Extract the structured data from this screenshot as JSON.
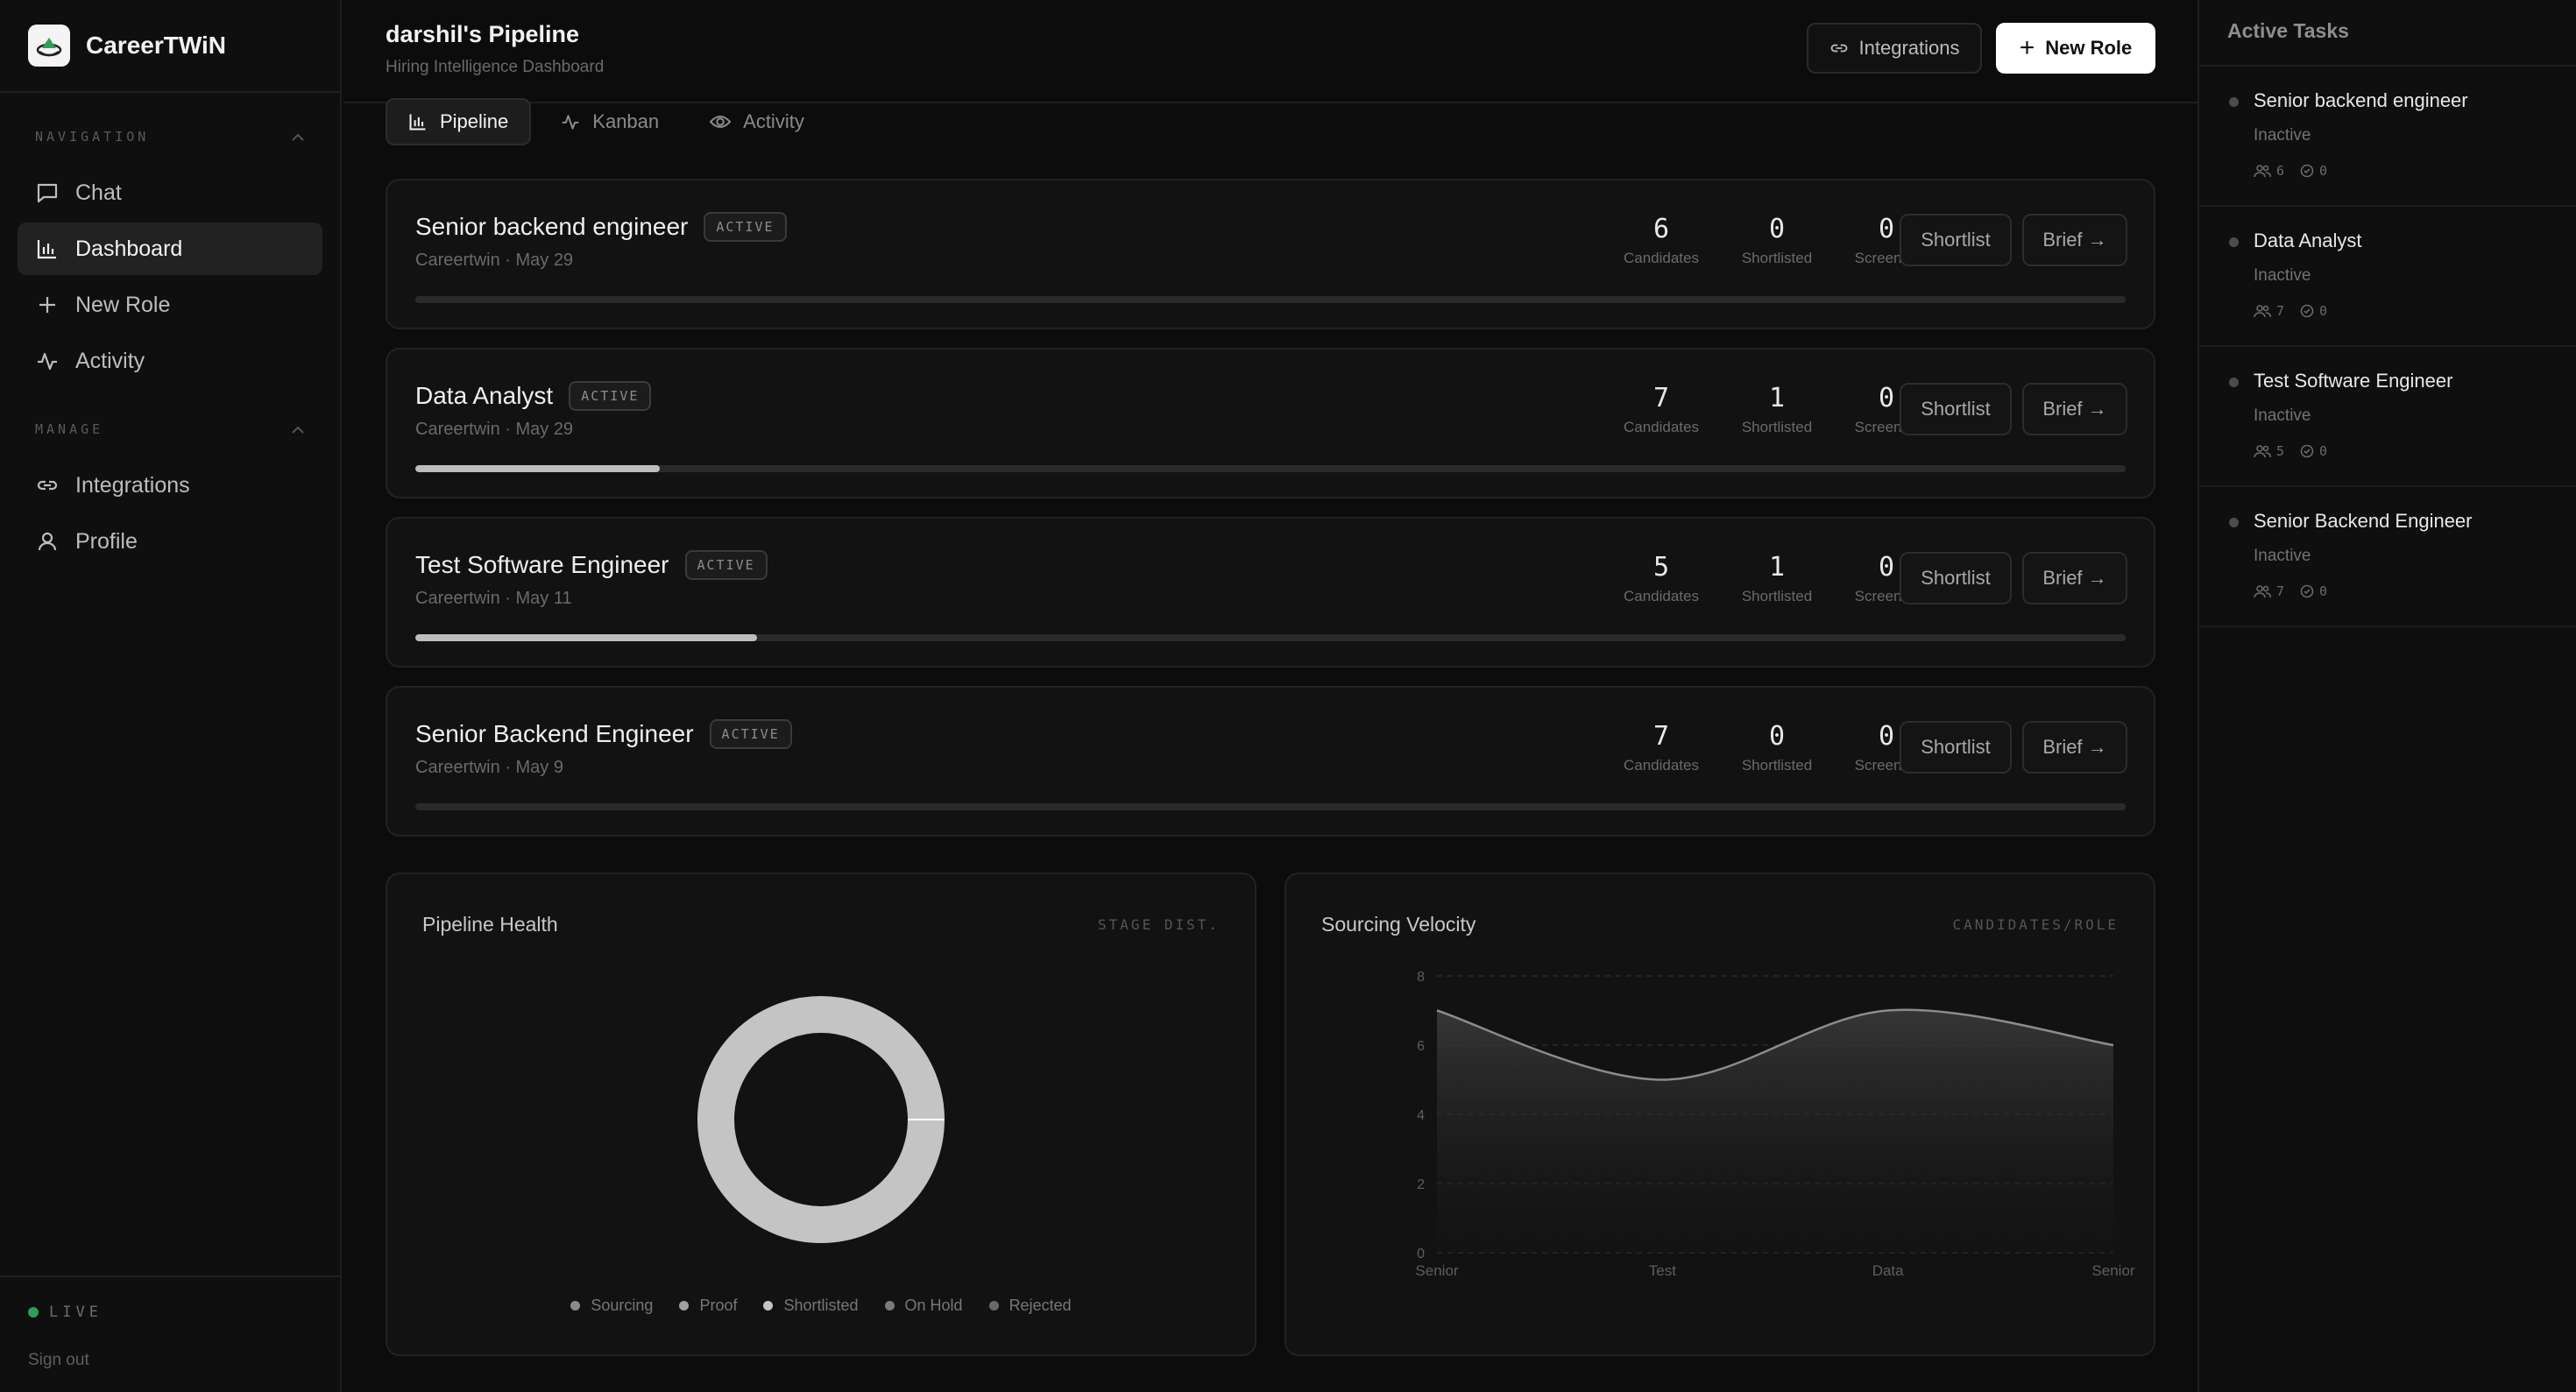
{
  "sidebar": {
    "brand": "CareerTWiN",
    "sections": [
      {
        "label": "NAVIGATION",
        "items": [
          {
            "label": "Chat",
            "icon": "chat-icon"
          },
          {
            "label": "Dashboard",
            "icon": "bar-chart-icon",
            "active": true
          },
          {
            "label": "New Role",
            "icon": "plus-icon"
          },
          {
            "label": "Activity",
            "icon": "activity-icon"
          }
        ]
      },
      {
        "label": "MANAGE",
        "items": [
          {
            "label": "Integrations",
            "icon": "link-icon"
          },
          {
            "label": "Profile",
            "icon": "user-icon"
          }
        ]
      }
    ],
    "live_label": "LIVE",
    "signout": "Sign out"
  },
  "header": {
    "title": "darshil's Pipeline",
    "subtitle": "Hiring Intelligence Dashboard",
    "integrations_label": "Integrations",
    "new_role_label": "New Role"
  },
  "tabs": [
    {
      "label": "Pipeline",
      "icon": "bar-chart-icon",
      "active": true
    },
    {
      "label": "Kanban",
      "icon": "activity-icon",
      "active": false
    },
    {
      "label": "Activity",
      "icon": "eye-icon",
      "active": false
    }
  ],
  "roles": [
    {
      "name": "Senior backend engineer",
      "status": "ACTIVE",
      "meta": "Careertwin · May 29",
      "candidates": "6",
      "shortlisted": "0",
      "screened": "0",
      "progress": 0
    },
    {
      "name": "Data Analyst",
      "status": "ACTIVE",
      "meta": "Careertwin · May 29",
      "candidates": "7",
      "shortlisted": "1",
      "screened": "0",
      "progress": 0.143
    },
    {
      "name": "Test Software Engineer",
      "status": "ACTIVE",
      "meta": "Careertwin · May 11",
      "candidates": "5",
      "shortlisted": "1",
      "screened": "0",
      "progress": 0.2
    },
    {
      "name": "Senior Backend Engineer",
      "status": "ACTIVE",
      "meta": "Careertwin · May 9",
      "candidates": "7",
      "shortlisted": "0",
      "screened": "0",
      "progress": 0
    }
  ],
  "role_labels": {
    "candidates": "Candidates",
    "shortlisted": "Shortlisted",
    "screened": "Screened",
    "shortlist_btn": "Shortlist",
    "brief_btn": "Brief →"
  },
  "panels": {
    "health": {
      "title": "Pipeline Health",
      "tag": "STAGE DIST."
    },
    "velocity": {
      "title": "Sourcing Velocity",
      "tag": "CANDIDATES/ROLE"
    }
  },
  "chart_data": [
    {
      "type": "pie",
      "title": "Pipeline Health",
      "categories": [
        "Sourcing",
        "Proof",
        "Shortlisted",
        "On Hold",
        "Rejected"
      ],
      "values": [
        0,
        0,
        2,
        0,
        0
      ],
      "colors": [
        "#8a8a8a",
        "#a0a0a0",
        "#c4c4c4",
        "#7a7a7a",
        "#6a6a6a"
      ]
    },
    {
      "type": "area",
      "title": "Sourcing Velocity",
      "categories": [
        "Senior",
        "Test",
        "Data",
        "Senior"
      ],
      "values": [
        7,
        5,
        7,
        6
      ],
      "ylim": [
        0,
        8
      ],
      "yticks": [
        0,
        2,
        4,
        6,
        8
      ],
      "grid": true
    }
  ],
  "active_tasks": {
    "title": "Active Tasks",
    "items": [
      {
        "name": "Senior backend engineer",
        "status": "Inactive",
        "candidates": "6",
        "done": "0"
      },
      {
        "name": "Data Analyst",
        "status": "Inactive",
        "candidates": "7",
        "done": "0"
      },
      {
        "name": "Test Software Engineer",
        "status": "Inactive",
        "candidates": "5",
        "done": "0"
      },
      {
        "name": "Senior Backend Engineer",
        "status": "Inactive",
        "candidates": "7",
        "done": "0"
      }
    ]
  }
}
